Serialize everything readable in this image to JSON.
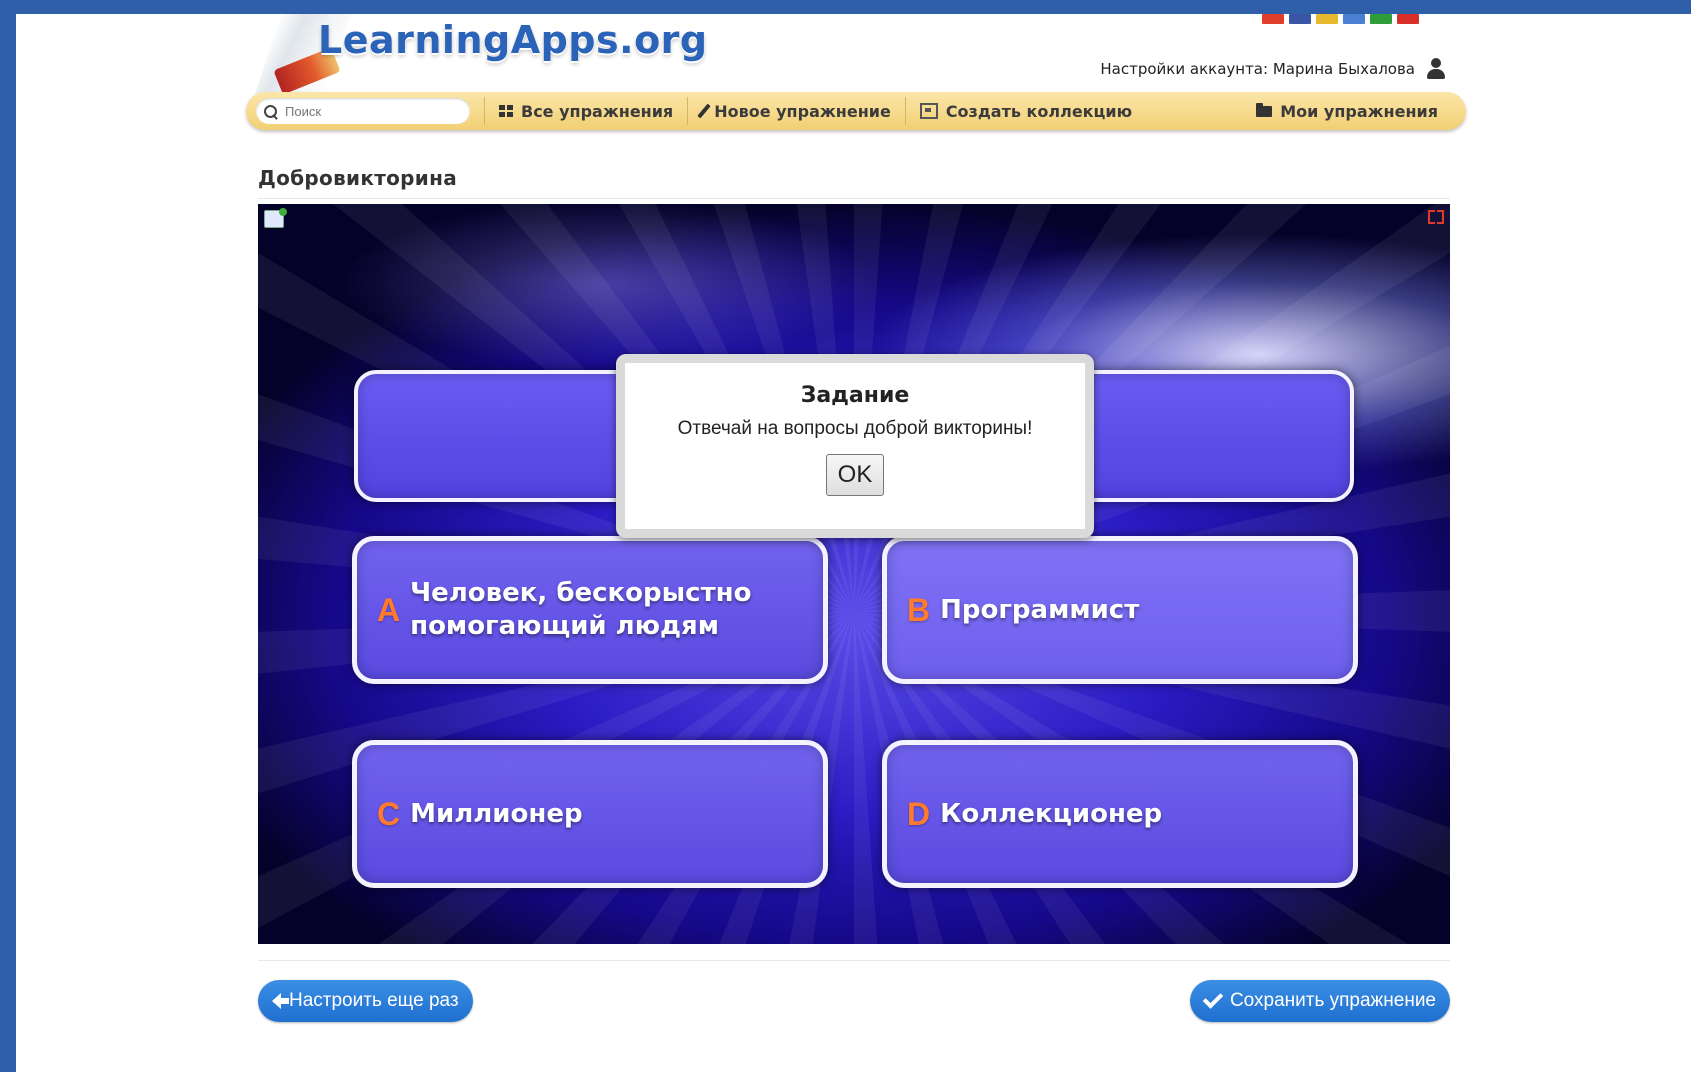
{
  "header": {
    "logo_text": "LearningApps.org",
    "account_label": "Настройки аккаунта: Марина Быхалова",
    "flags": [
      "#e03e2d",
      "#3a55a6",
      "#e8b92e",
      "#4b7fd1",
      "#2f9d3a",
      "#d7302b"
    ]
  },
  "nav": {
    "search_placeholder": "Поиск",
    "all_exercises": "Все упражнения",
    "new_exercise": "Новое упражнение",
    "create_collection": "Создать коллекцию",
    "my_exercises": "Мои упражнения"
  },
  "page": {
    "title": "Добровикторина"
  },
  "dialog": {
    "title": "Задание",
    "text": "Отвечай на вопросы доброй викторины!",
    "ok_label": "OK"
  },
  "answers": [
    {
      "letter": "A",
      "line1": "Человек, бескорыстно",
      "line2": "помогающий людям"
    },
    {
      "letter": "B",
      "text": "Программист"
    },
    {
      "letter": "C",
      "text": "Миллионер"
    },
    {
      "letter": "D",
      "text": "Коллекционер"
    }
  ],
  "footer": {
    "reconfigure_label": "Настроить еще раз",
    "save_label": "Сохранить упражнение"
  },
  "colors": {
    "nav_bar": "#f2cf74",
    "button_blue": "#1f6fd0",
    "answer_letter": "#ff7a2c",
    "outer_background": "#2f5fa8"
  }
}
